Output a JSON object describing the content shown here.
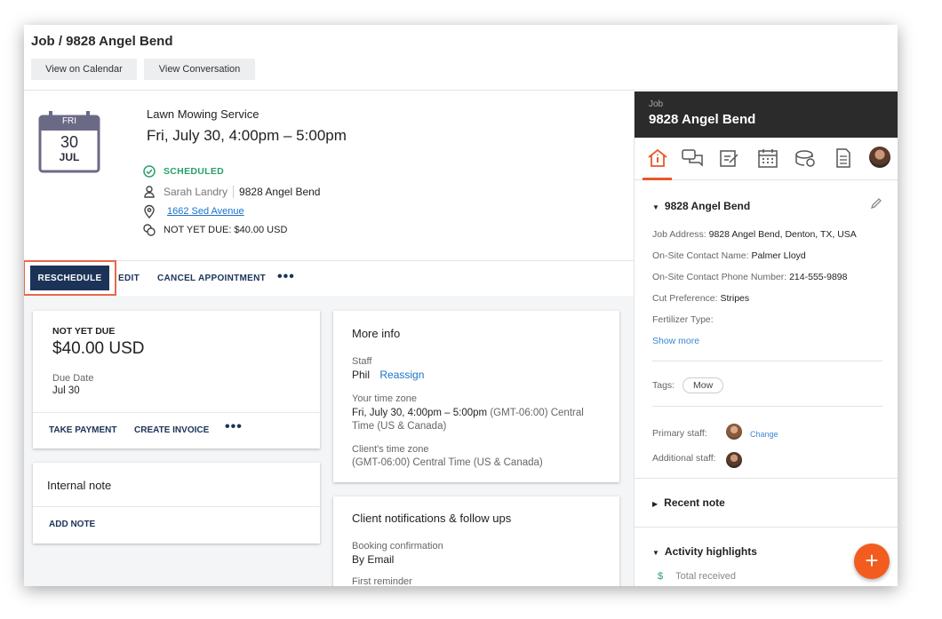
{
  "header": {
    "breadcrumb": "Job / 9828 Angel Bend",
    "view_calendar": "View on Calendar",
    "view_conversation": "View Conversation"
  },
  "appointment": {
    "cal_day": "FRI",
    "cal_date": "30",
    "cal_month": "JUL",
    "service": "Lawn Mowing Service",
    "datetime": "Fri, July 30, 4:00pm – 5:00pm",
    "status": "SCHEDULED",
    "client_name": "Sarah Landry",
    "property": "9828 Angel Bend",
    "address_link": "1662 Sed Avenue",
    "payment_status": "NOT YET DUE: $40.00 USD",
    "status_color": "#27a06b"
  },
  "actions": {
    "reschedule": "RESCHEDULE",
    "edit": "EDIT",
    "cancel": "CANCEL APPOINTMENT",
    "more": "•••"
  },
  "payment_card": {
    "status": "NOT YET DUE",
    "amount": "$40.00 USD",
    "due_label": "Due Date",
    "due_value": "Jul 30",
    "take_payment": "TAKE PAYMENT",
    "create_invoice": "CREATE INVOICE",
    "more": "•••"
  },
  "note_card": {
    "title": "Internal note",
    "add_note": "ADD NOTE"
  },
  "more_info": {
    "title": "More info",
    "staff_label": "Staff",
    "staff_value": "Phil",
    "reassign": "Reassign",
    "your_tz_label": "Your time zone",
    "your_tz_value": "Fri, July 30, 4:00pm – 5:00pm",
    "your_tz_suffix": "(GMT-06:00) Central",
    "your_tz_line2": "Time (US & Canada)",
    "client_tz_label": "Client's time zone",
    "client_tz_value": "(GMT-06:00) Central Time (US & Canada)"
  },
  "notifications": {
    "title": "Client notifications & follow ups",
    "booking_label": "Booking confirmation",
    "booking_value": "By Email",
    "first_reminder": "First reminder"
  },
  "sidebar": {
    "kicker": "Job",
    "title": "9828 Angel Bend",
    "section_title": "9828 Angel Bend",
    "job_address_label": "Job Address:",
    "job_address": "9828 Angel Bend, Denton, TX, USA",
    "contact_name_label": "On-Site Contact Name:",
    "contact_name": "Palmer Lloyd",
    "contact_phone_label": "On-Site Contact Phone Number:",
    "contact_phone": "214-555-9898",
    "cut_pref_label": "Cut Preference:",
    "cut_pref": "Stripes",
    "fertilizer_label": "Fertilizer Type:",
    "show_more": "Show more",
    "tags_label": "Tags:",
    "tag": "Mow",
    "primary_staff_label": "Primary staff:",
    "change": "Change",
    "additional_staff_label": "Additional staff:",
    "recent_note": "Recent note",
    "activity": "Activity highlights",
    "total_received": "Total received",
    "accent_color": "#e8582b"
  },
  "fab": "+"
}
